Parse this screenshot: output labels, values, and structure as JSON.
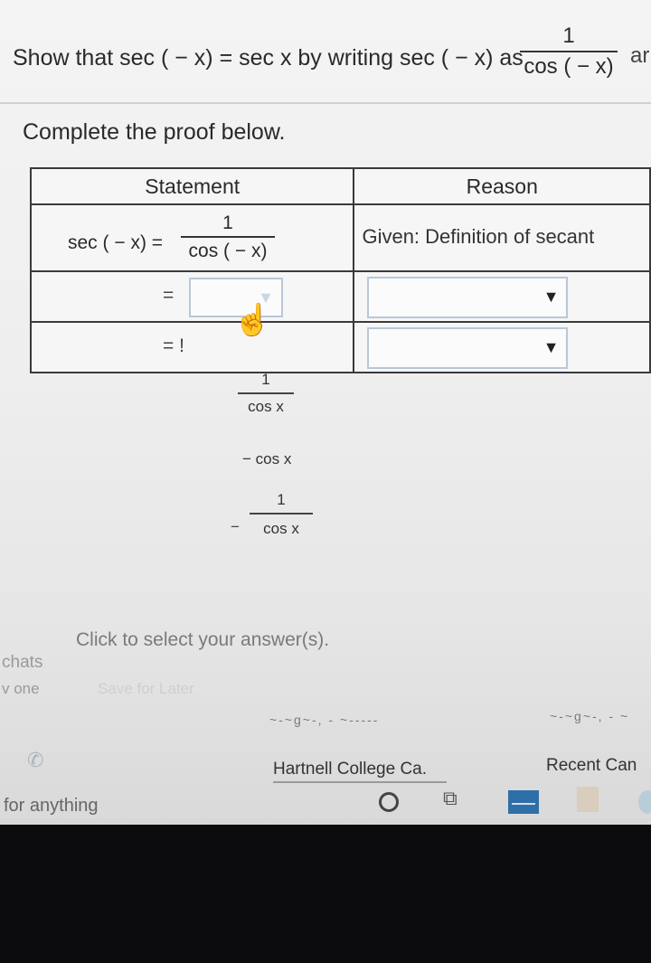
{
  "prompt": {
    "text": "Show that sec ( − x) = sec x by writing sec ( − x) as",
    "fraction_numerator": "1",
    "fraction_denominator": "cos ( − x)",
    "cut_text": "ar"
  },
  "instruction": "Complete the proof below.",
  "table": {
    "header_statement": "Statement",
    "header_reason": "Reason",
    "row1": {
      "lhs": "sec ( − x) =",
      "numerator": "1",
      "denominator": "cos ( − x)",
      "reason": "Given: Definition of secant"
    },
    "row2": {
      "eq": "="
    },
    "row3": {
      "eq": "= !"
    }
  },
  "options": [
    {
      "numerator": "1",
      "denominator": "cos x"
    },
    {
      "text": "− cos x"
    },
    {
      "minus": "−",
      "numerator": "1",
      "denominator": "cos x"
    }
  ],
  "hint": "Click to select your answer(s).",
  "side": {
    "line1": "chats",
    "line2": "v one"
  },
  "save_later": "Save for Later",
  "browser_tabs": {
    "tab1": "Hartnell College Ca.",
    "tab2": "Recent Can",
    "squiggle1": "~-~g~-, - ~-----",
    "squiggle2": "~-~g~-, - ~"
  },
  "taskbar": {
    "search_text": "for anything"
  },
  "colors": {
    "screen_bg": "#eeeeee",
    "dropdown_border": "#b8c8d8",
    "mail_icon": "#2f6fa8"
  }
}
